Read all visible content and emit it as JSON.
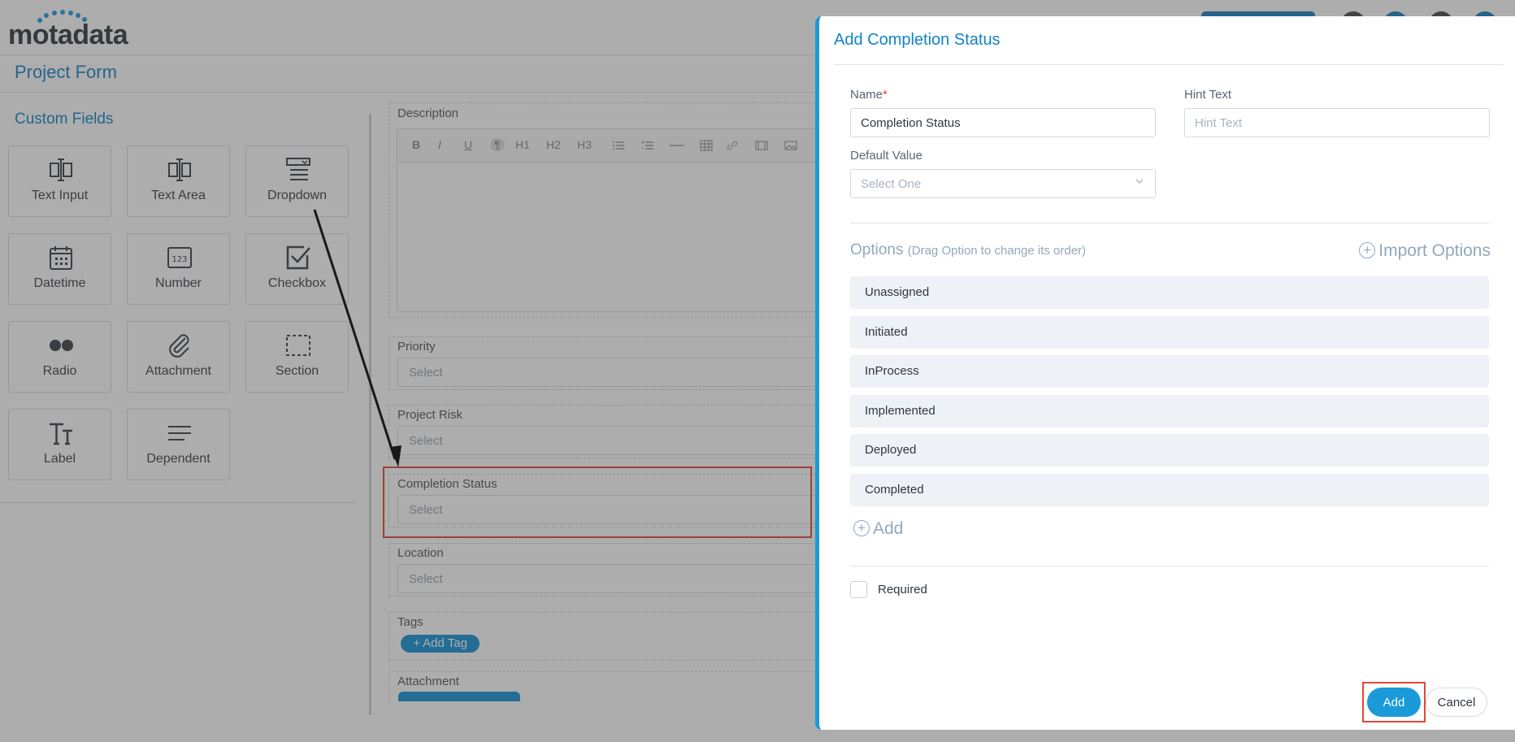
{
  "app": {
    "logo": "motadata",
    "page_title": "Project Form",
    "custom_fields_title": "Custom Fields",
    "palette": [
      {
        "label": "Text Input",
        "icon": "text-input-icon"
      },
      {
        "label": "Text Area",
        "icon": "text-area-icon"
      },
      {
        "label": "Dropdown",
        "icon": "dropdown-icon"
      },
      {
        "label": "Datetime",
        "icon": "calendar-icon"
      },
      {
        "label": "Number",
        "icon": "number-icon"
      },
      {
        "label": "Checkbox",
        "icon": "checkbox-icon"
      },
      {
        "label": "Radio",
        "icon": "radio-icon"
      },
      {
        "label": "Attachment",
        "icon": "paperclip-icon"
      },
      {
        "label": "Section",
        "icon": "section-icon"
      },
      {
        "label": "Label",
        "icon": "label-icon"
      },
      {
        "label": "Dependent",
        "icon": "dependent-icon"
      }
    ],
    "form_fields": {
      "description_label": "Description",
      "editor_toolbar": [
        "B",
        "I",
        "U",
        "¶",
        "H1",
        "H2",
        "H3"
      ],
      "priority_label": "Priority",
      "priority_placeholder": "Select",
      "project_risk_label": "Project Risk",
      "project_risk_placeholder": "Select",
      "completion_status_label": "Completion Status",
      "completion_status_placeholder": "Select",
      "location_label": "Location",
      "location_placeholder": "Select",
      "tags_label": "Tags",
      "add_tag_label": "+ Add Tag",
      "attachment_label": "Attachment"
    }
  },
  "drawer": {
    "title": "Add Completion Status",
    "name_label": "Name",
    "name_required_mark": "*",
    "name_value": "Completion Status",
    "hint_label": "Hint Text",
    "hint_placeholder": "Hint Text",
    "default_label": "Default Value",
    "default_placeholder": "Select One",
    "options_title": "Options",
    "options_hint": "(Drag Option to change its order)",
    "import_options": "Import Options",
    "options": [
      "Unassigned",
      "Initiated",
      "InProcess",
      "Implemented",
      "Deployed",
      "Completed"
    ],
    "add_option": "Add",
    "required_label": "Required",
    "add_button": "Add",
    "cancel_button": "Cancel"
  },
  "colors": {
    "accent": "#1a9ad9",
    "title_blue": "#1383c6",
    "highlight_red": "#e6453b",
    "option_bg": "#eef1f5"
  }
}
